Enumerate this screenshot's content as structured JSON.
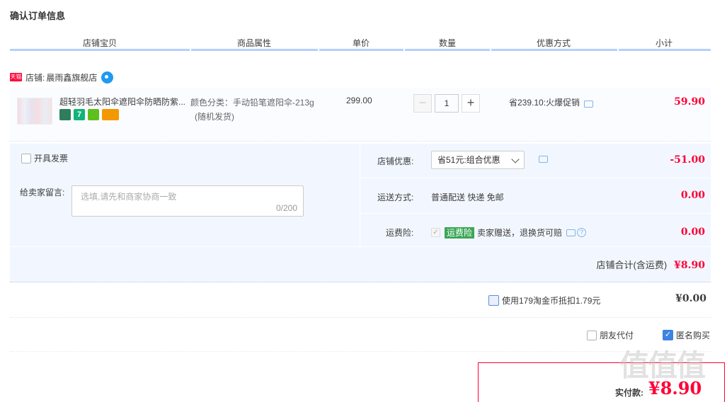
{
  "page": {
    "title": "确认订单信息"
  },
  "columns": {
    "item": "店铺宝贝",
    "attr": "商品属性",
    "price": "单价",
    "qty": "数量",
    "promo": "优惠方式",
    "subtotal": "小计"
  },
  "shop": {
    "badge": "天猫",
    "label": "店铺:",
    "name": "晨雨鑫旗舰店"
  },
  "item": {
    "title": "超轻羽毛太阳伞遮阳伞防晒防紫...",
    "attr_line1": "颜色分类：手动铅笔遮阳伞-213g",
    "attr_line2": "(随机发货)",
    "price": "299.00",
    "qty": "1",
    "qty_minus": "−",
    "qty_plus": "+",
    "promo": "省239.10:火爆促销",
    "subtotal": "59.90",
    "icon_7": "7"
  },
  "invoice": {
    "label": "开具发票"
  },
  "memo": {
    "label": "给卖家留言:",
    "placeholder": "选填,请先和商家协商一致",
    "count": "0/200"
  },
  "shop_discount": {
    "label": "店铺优惠:",
    "selected": "省51元:组合优惠",
    "amount": "-51.00"
  },
  "shipping": {
    "label": "运送方式:",
    "value": "普通配送 快递 免邮",
    "amount": "0.00"
  },
  "insurance": {
    "label": "运费险:",
    "badge": "运费险",
    "text": "卖家赠送，退换货可赔",
    "amount": "0.00",
    "check": "✓",
    "help": "?"
  },
  "shop_total": {
    "label": "店铺合计(含运费)",
    "value": "¥8.90"
  },
  "coins": {
    "label": "使用179淘金币抵扣1.79元",
    "amount": "¥0.00"
  },
  "friend_pay": {
    "label": "朋友代付"
  },
  "anonymous": {
    "label": "匿名购买",
    "check": "✓"
  },
  "payment": {
    "label": "实付款:",
    "amount": "¥8.90"
  },
  "watermark": "值值值",
  "colors": {
    "accent_red": "#ff0036",
    "header_line": "#b2d1ff",
    "panel_bg": "#f2f7ff",
    "checkbox_blue": "#3d83e0",
    "insurance_green": "#3aa757"
  }
}
